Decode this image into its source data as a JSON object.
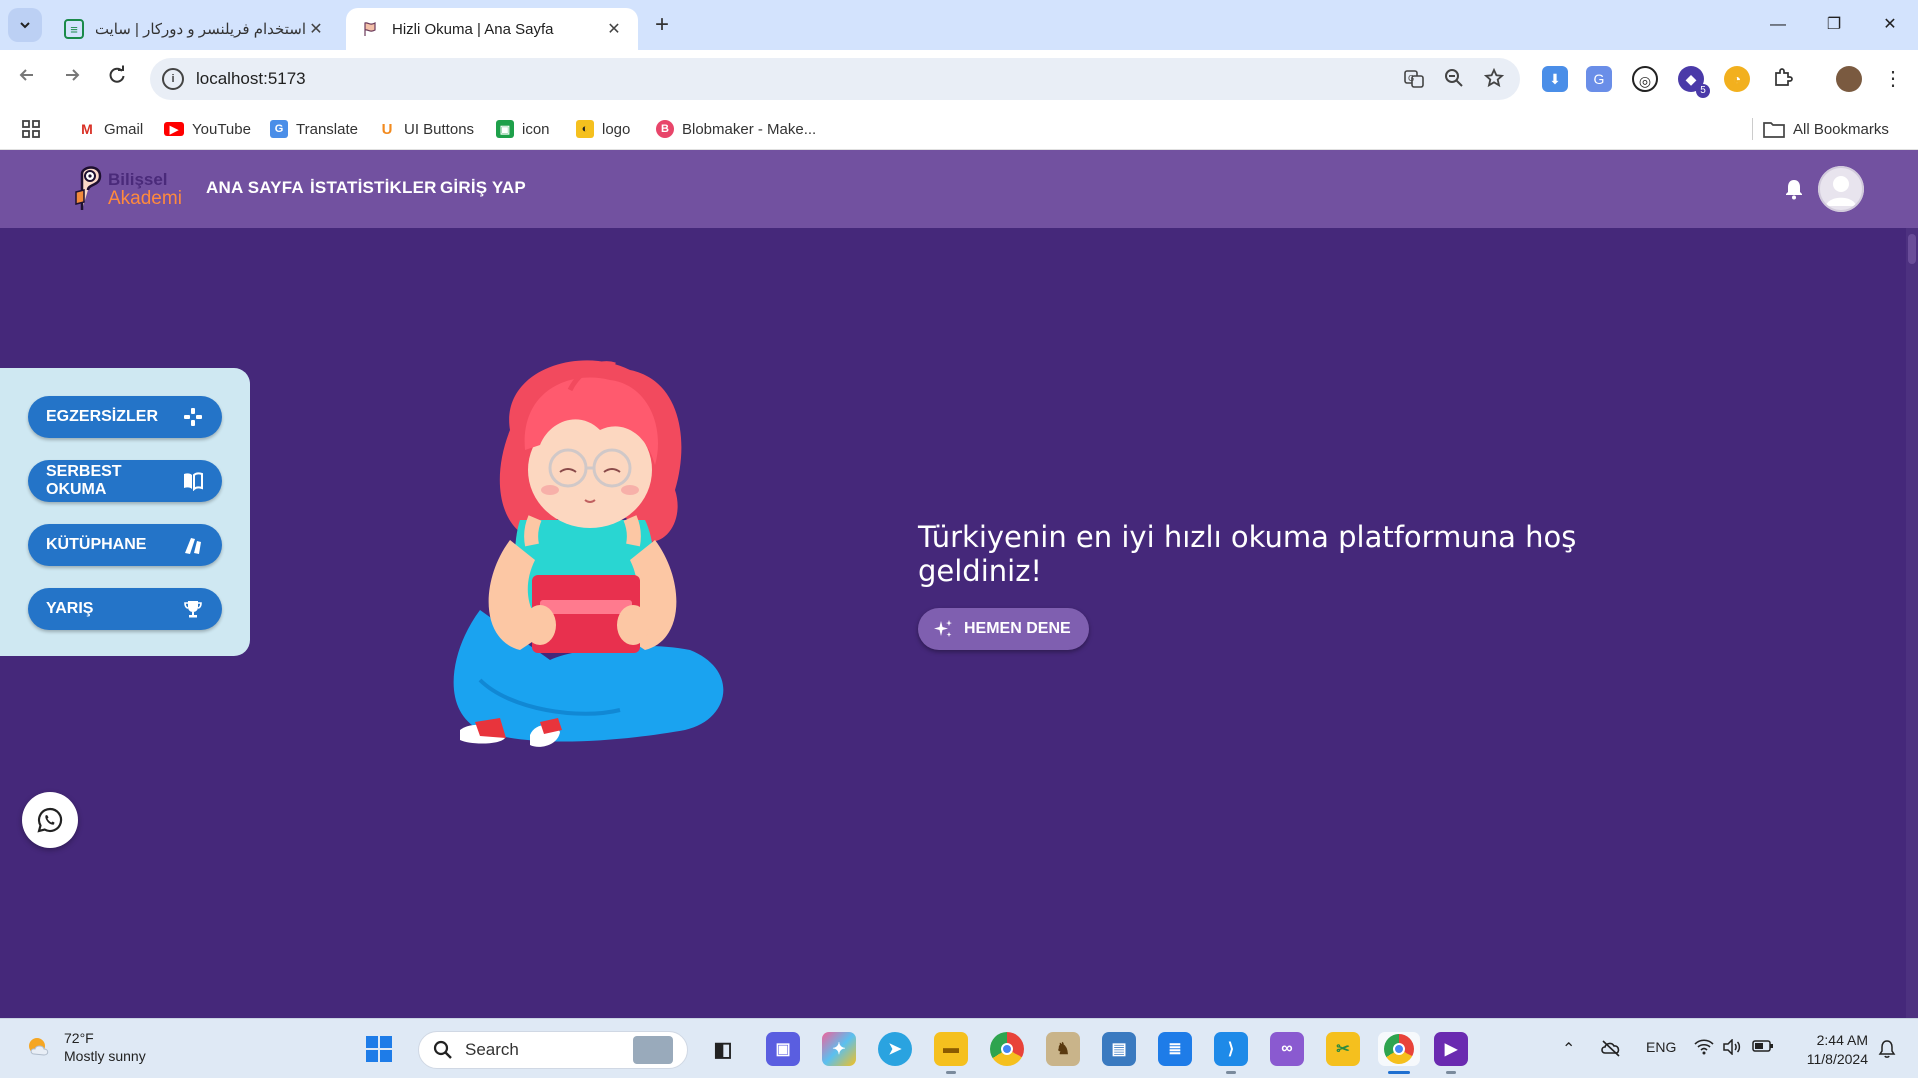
{
  "browser": {
    "tabs": [
      {
        "title": "استخدام فریلنسر و دورکار | سایت",
        "active": false
      },
      {
        "title": "Hizli Okuma | Ana Sayfa",
        "active": true
      }
    ],
    "url": "localhost:5173",
    "bookmarks": [
      {
        "label": "Gmail",
        "icon": "gmail-icon"
      },
      {
        "label": "YouTube",
        "icon": "youtube-icon"
      },
      {
        "label": "Translate",
        "icon": "translate-icon"
      },
      {
        "label": "UI Buttons",
        "icon": "ui-buttons-icon"
      },
      {
        "label": "icon",
        "icon": "icon-site-icon"
      },
      {
        "label": "logo",
        "icon": "logo-site-icon"
      },
      {
        "label": "Blobmaker - Make...",
        "icon": "blobmaker-icon"
      }
    ],
    "all_bookmarks": "All Bookmarks",
    "extension_badge": "5"
  },
  "app": {
    "logo": {
      "line1": "Bilişsel",
      "line2": "Akademi"
    },
    "nav": [
      "ANA SAYFA",
      "İSTATİSTİKLER",
      "GİRİŞ YAP"
    ],
    "side_menu": [
      {
        "label": "EGZERSİZLER",
        "icon": "gamepad-icon"
      },
      {
        "label": "SERBEST OKUMA",
        "icon": "book-icon"
      },
      {
        "label": "KÜTÜPHANE",
        "icon": "books-icon"
      },
      {
        "label": "YARIŞ",
        "icon": "trophy-icon"
      }
    ],
    "hero_title": "Türkiyenin en iyi hızlı okuma platformuna hoş geldiniz!",
    "cta_label": "HEMEN DENE"
  },
  "taskbar": {
    "weather": {
      "temp": "72°F",
      "desc": "Mostly sunny"
    },
    "search_placeholder": "Search",
    "language": "ENG",
    "time": "2:44 AM",
    "date": "11/8/2024"
  },
  "colors": {
    "app_bg": "#45287a",
    "appbar": "#7251a0",
    "side_panel": "#cfe8f2",
    "side_button": "#2474c8",
    "cta": "#7f5fb0"
  }
}
